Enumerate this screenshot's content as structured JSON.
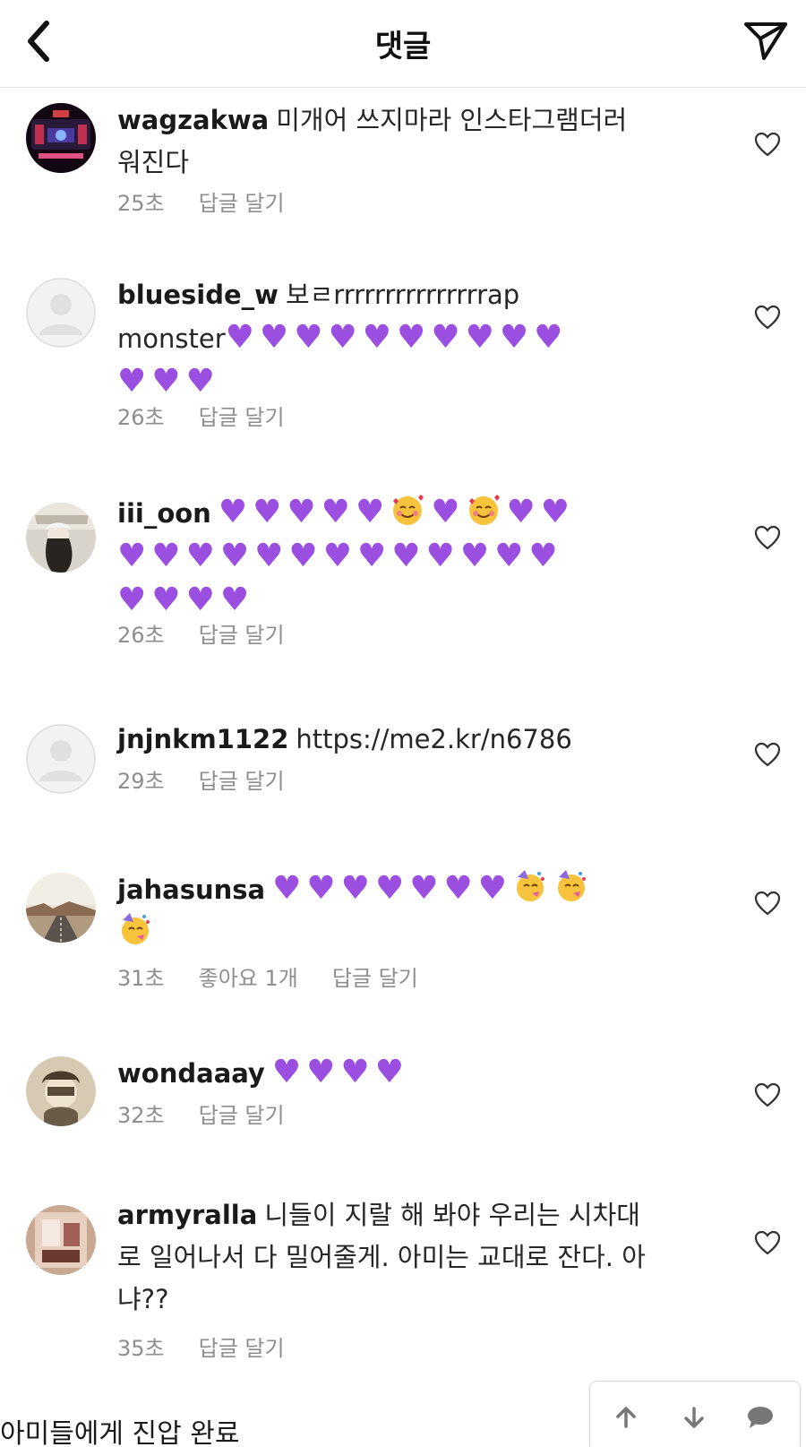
{
  "header": {
    "title": "댓글",
    "back_icon": "chevron-left-icon",
    "send_icon": "send-icon"
  },
  "colors": {
    "heart_purple": "#9b4fe0",
    "meta_gray": "#8e8e8e",
    "text": "#262626",
    "divider": "#e6e6e6"
  },
  "comments": [
    {
      "username": "wagzakwa",
      "text_line1": "미개어 쓰지마라 인스타그램더러",
      "text_line2": "워진다",
      "time": "25초",
      "reply": "답글 달기"
    },
    {
      "username": "blueside_w",
      "text_line1": "보ㄹrrrrrrrrrrrrrrrap",
      "text_line2": "monster",
      "time": "26초",
      "reply": "답글 달기"
    },
    {
      "username": "iii_oon",
      "time": "26초",
      "reply": "답글 달기"
    },
    {
      "username": "jnjnkm1122",
      "text_line1": "https://me2.kr/n6786",
      "time": "29초",
      "reply": "답글 달기"
    },
    {
      "username": "jahasunsa",
      "time": "31초",
      "likes": "좋아요 1개",
      "reply": "답글 달기"
    },
    {
      "username": "wondaaay",
      "time": "32초",
      "reply": "답글 달기"
    },
    {
      "username": "armyralla",
      "text_line1": "니들이 지랄 해 봐야 우리는 시차대",
      "text_line2": "로 일어나서 다 밀어줄게. 아미는 교대로 잔다. 아",
      "text_line3": "냐??",
      "time": "35초",
      "reply": "답글 달기"
    }
  ],
  "caption": "아미들에게 진압 완료",
  "float_bar": {
    "up_icon": "arrow-up-icon",
    "down_icon": "arrow-down-icon",
    "chat_icon": "chat-bubble-icon"
  }
}
